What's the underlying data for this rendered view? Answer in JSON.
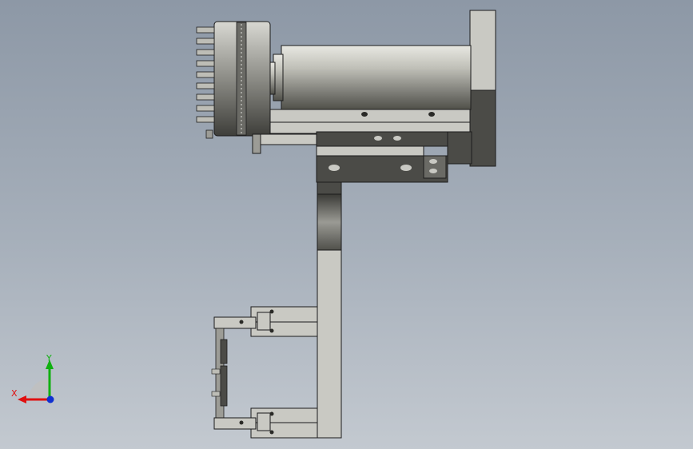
{
  "triad": {
    "x_label": "X",
    "y_label": "Y",
    "x_color": "#e01010",
    "y_color": "#10b010",
    "z_color": "#1030d0"
  },
  "model": {
    "part_colors": {
      "light_gray": "#c9c9c3",
      "mid_gray": "#9c9c96",
      "dark_gray": "#4b4b47",
      "outline": "#1c1c1c"
    },
    "parts": [
      "motor-flange",
      "cylinder-body",
      "rotary-head",
      "vertical-arm",
      "upper-gripper",
      "lower-gripper",
      "mounting-plate"
    ]
  }
}
